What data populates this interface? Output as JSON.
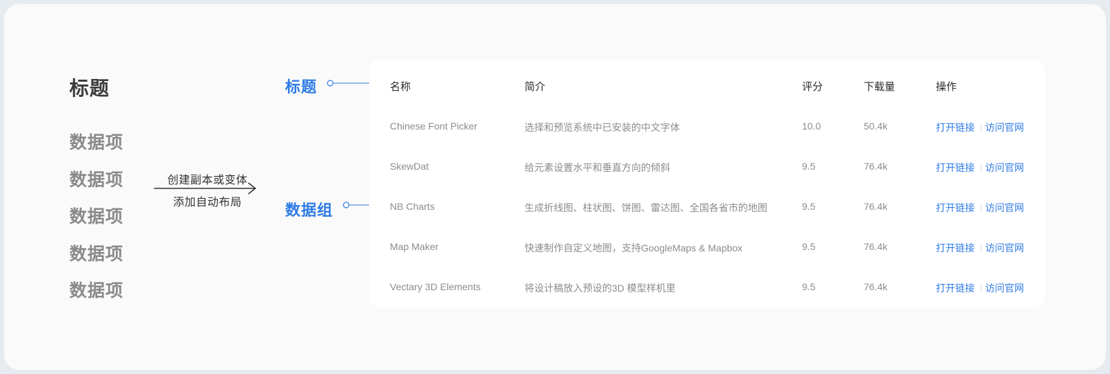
{
  "left": {
    "title": "标题",
    "items": [
      "数据项",
      "数据项",
      "数据项",
      "数据项",
      "数据项"
    ]
  },
  "arrow": {
    "top_label": "创建副本或变体",
    "bottom_label": "添加自动布局"
  },
  "labels": {
    "title": "标题",
    "group": "数据组"
  },
  "table": {
    "headers": [
      "名称",
      "简介",
      "评分",
      "下载量",
      "操作"
    ],
    "rows": [
      {
        "name": "Chinese Font Picker",
        "desc": "选择和预览系统中已安装的中文字体",
        "score": "10.0",
        "downloads": "50.4k",
        "action_open": "打开链接",
        "action_visit": "访问官网"
      },
      {
        "name": "SkewDat",
        "desc": "给元素设置水平和垂直方向的倾斜",
        "score": "9.5",
        "downloads": "76.4k",
        "action_open": "打开链接",
        "action_visit": "访问官网"
      },
      {
        "name": "NB Charts",
        "desc": "生成折线图、柱状图、饼图、雷达图、全国各省市的地图",
        "score": "9.5",
        "downloads": "76.4k",
        "action_open": "打开链接",
        "action_visit": "访问官网"
      },
      {
        "name": "Map Maker",
        "desc": "快速制作自定义地图，支持GoogleMaps & Mapbox",
        "score": "9.5",
        "downloads": "76.4k",
        "action_open": "打开链接",
        "action_visit": "访问官网"
      },
      {
        "name": "Vectary 3D Elements",
        "desc": "将设计稿放入预设的3D 模型样机里",
        "score": "9.5",
        "downloads": "76.4k",
        "action_open": "打开链接",
        "action_visit": "访问官网"
      }
    ]
  },
  "colors": {
    "accent": "#2f7be6",
    "muted_text": "#8a8a8a",
    "dark_text": "#3d3d3d"
  }
}
